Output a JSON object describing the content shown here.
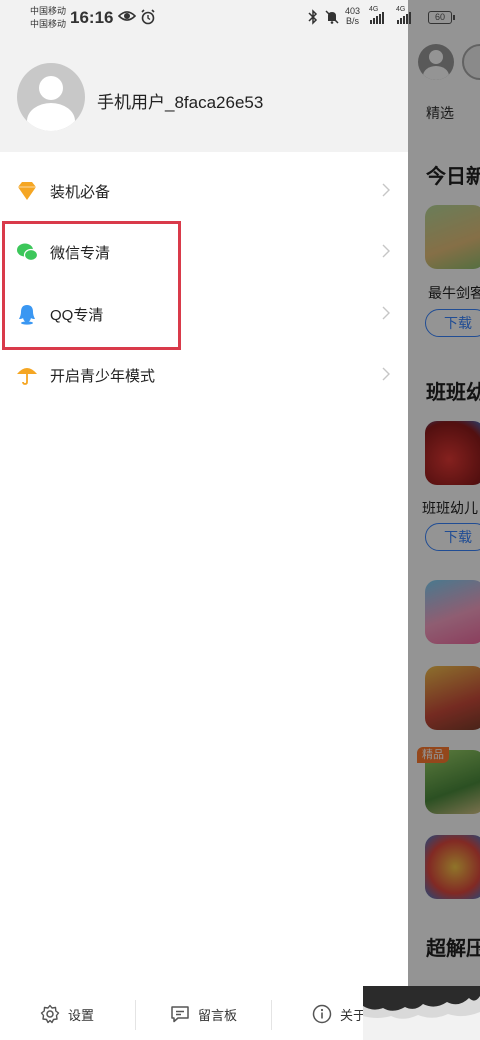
{
  "status_bar": {
    "carrier1": "中国移动",
    "carrier2": "中国移动",
    "time": "16:16",
    "net_speed_value": "403",
    "net_speed_unit": "B/s",
    "signal1_label": "4G",
    "signal2_label": "4G",
    "battery": "60"
  },
  "drawer": {
    "username": "手机用户_8faca26e53",
    "menu": [
      {
        "label": "装机必备",
        "icon": "diamond-icon",
        "color": "#f5a623"
      },
      {
        "label": "微信专清",
        "icon": "wechat-icon",
        "color": "#3cc75a"
      },
      {
        "label": "QQ专清",
        "icon": "qq-icon",
        "color": "#3a97f2"
      },
      {
        "label": "开启青少年模式",
        "icon": "umbrella-icon",
        "color": "#f5a623"
      }
    ],
    "highlight_color": "#d93a4a",
    "bottom": {
      "settings": "设置",
      "board": "留言板",
      "about": "关于"
    }
  },
  "background_app": {
    "tab": "精选",
    "section1": "今日新",
    "game1_name": "最牛剑客",
    "download1": "下载",
    "section2": "班班幼",
    "game2_name": "班班幼儿",
    "download2": "下载",
    "badge": "精品",
    "section3": "超解压"
  }
}
